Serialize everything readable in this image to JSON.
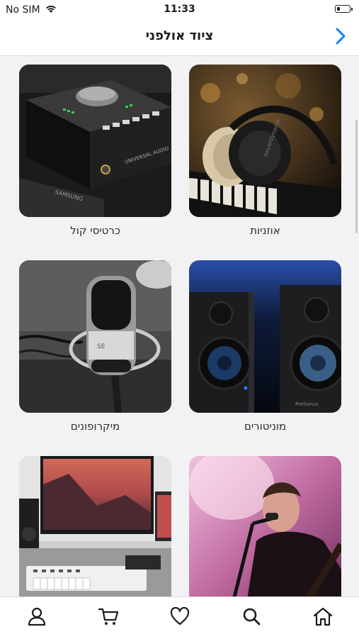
{
  "status_bar": {
    "carrier": "No SIM",
    "time": "11:33"
  },
  "header": {
    "title": "ציוד אולפני"
  },
  "categories": [
    {
      "label": "אוזניות",
      "image": "headphones-on-keyboard"
    },
    {
      "label": "כרטיסי קול",
      "image": "audio-interface"
    },
    {
      "label": "מוניטורים",
      "image": "studio-monitor-speakers"
    },
    {
      "label": "מיקרופונים",
      "image": "condenser-microphone"
    },
    {
      "label": "",
      "image": "singer-with-guitar-on-stage"
    },
    {
      "label": "",
      "image": "studio-desk-with-monitor"
    }
  ],
  "tab_bar": {
    "items": [
      "home-icon",
      "search-icon",
      "heart-icon",
      "cart-icon",
      "user-icon"
    ],
    "accent": "#0a84ff"
  }
}
